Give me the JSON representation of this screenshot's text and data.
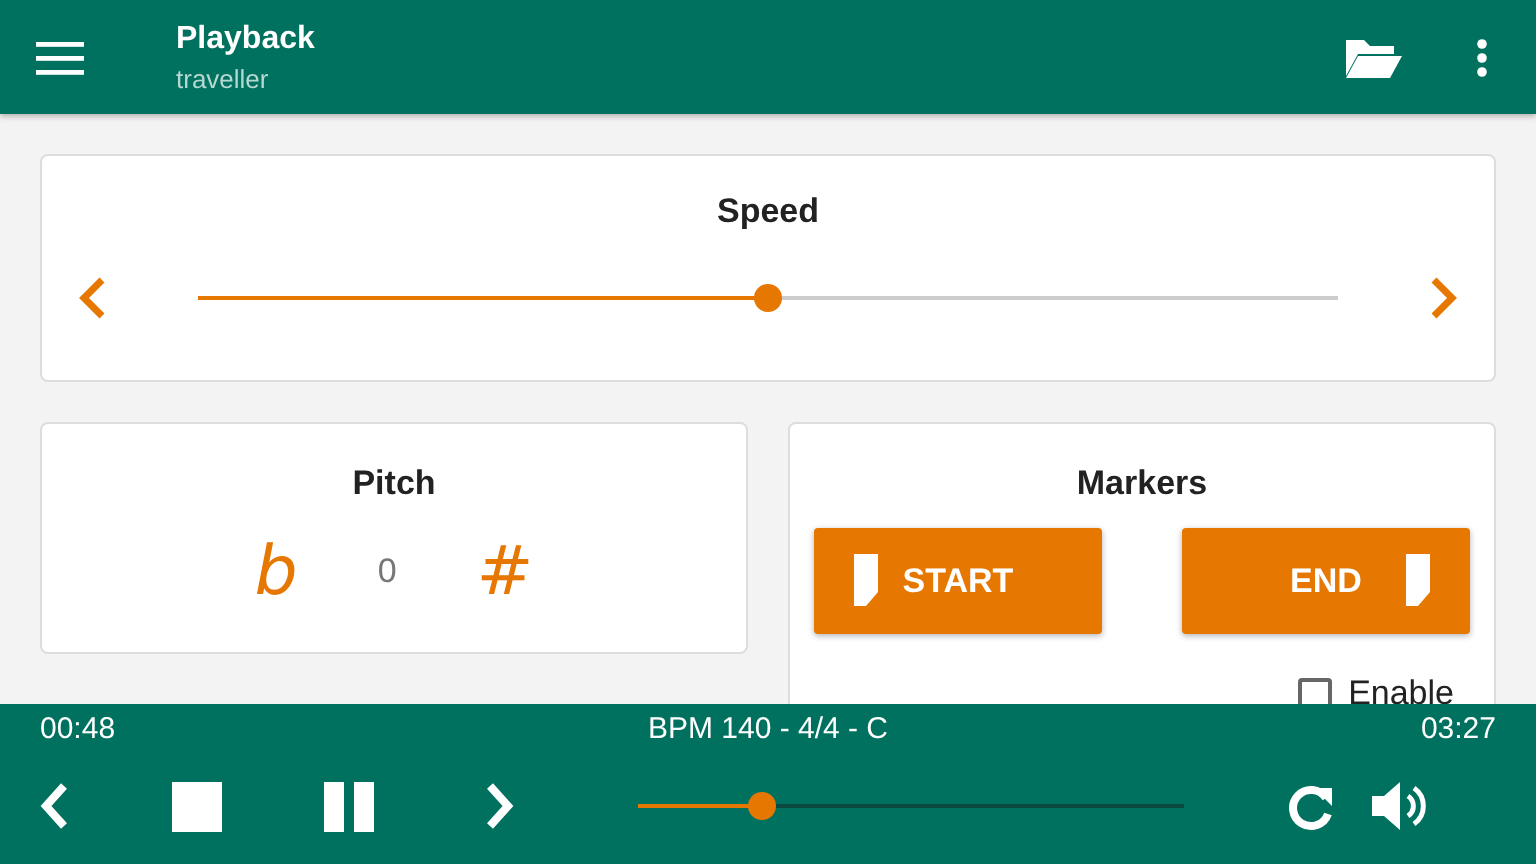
{
  "app_bar": {
    "title": "Playback",
    "subtitle": "traveller"
  },
  "speed": {
    "title": "Speed",
    "level": 0.5
  },
  "pitch": {
    "title": "Pitch",
    "flat": "b",
    "value": "0",
    "sharp": "#"
  },
  "markers": {
    "title": "Markers",
    "buttons": [
      "START",
      "END"
    ],
    "enable": {
      "label": "Enable",
      "checked": false
    }
  },
  "player": {
    "elapsed": "00:48",
    "info": "BPM 140 - 4/4 - C",
    "total": "03:27",
    "level": 0.227
  }
}
